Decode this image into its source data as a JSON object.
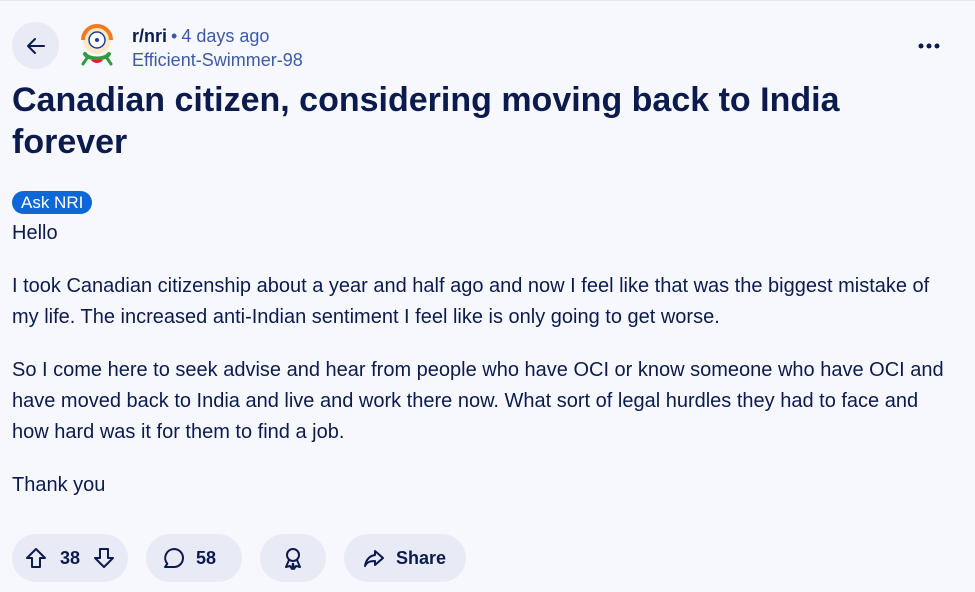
{
  "post": {
    "subreddit": "r/nri",
    "separator": "•",
    "time_ago": "4 days ago",
    "author": "Efficient-Swimmer-98",
    "title": "Canadian citizen, considering moving back to India forever",
    "flair": "Ask NRI",
    "body": [
      "Hello",
      "I took Canadian citizenship about a year and half ago and now I feel like that was the biggest mistake of my life. The increased anti-Indian sentiment I feel like is only going to get worse.",
      "So I come here to seek advise and hear from people who have OCI or know someone who have OCI and have moved back to India and live and work there now. What sort of legal hurdles they had to face and how hard was it for them to find a job.",
      "Thank you"
    ]
  },
  "actions": {
    "score": "38",
    "comments": "58",
    "share_label": "Share"
  },
  "icons": {
    "back": "back-arrow-icon",
    "more": "more-options-icon",
    "upvote": "upvote-icon",
    "downvote": "downvote-icon",
    "comment": "comment-icon",
    "award": "award-icon",
    "share": "share-icon"
  },
  "colors": {
    "background": "#f7f8fd",
    "pill": "#e8eaf6",
    "text": "#0b1b4d",
    "meta": "#3d5aa8",
    "flair": "#0c68d6"
  }
}
